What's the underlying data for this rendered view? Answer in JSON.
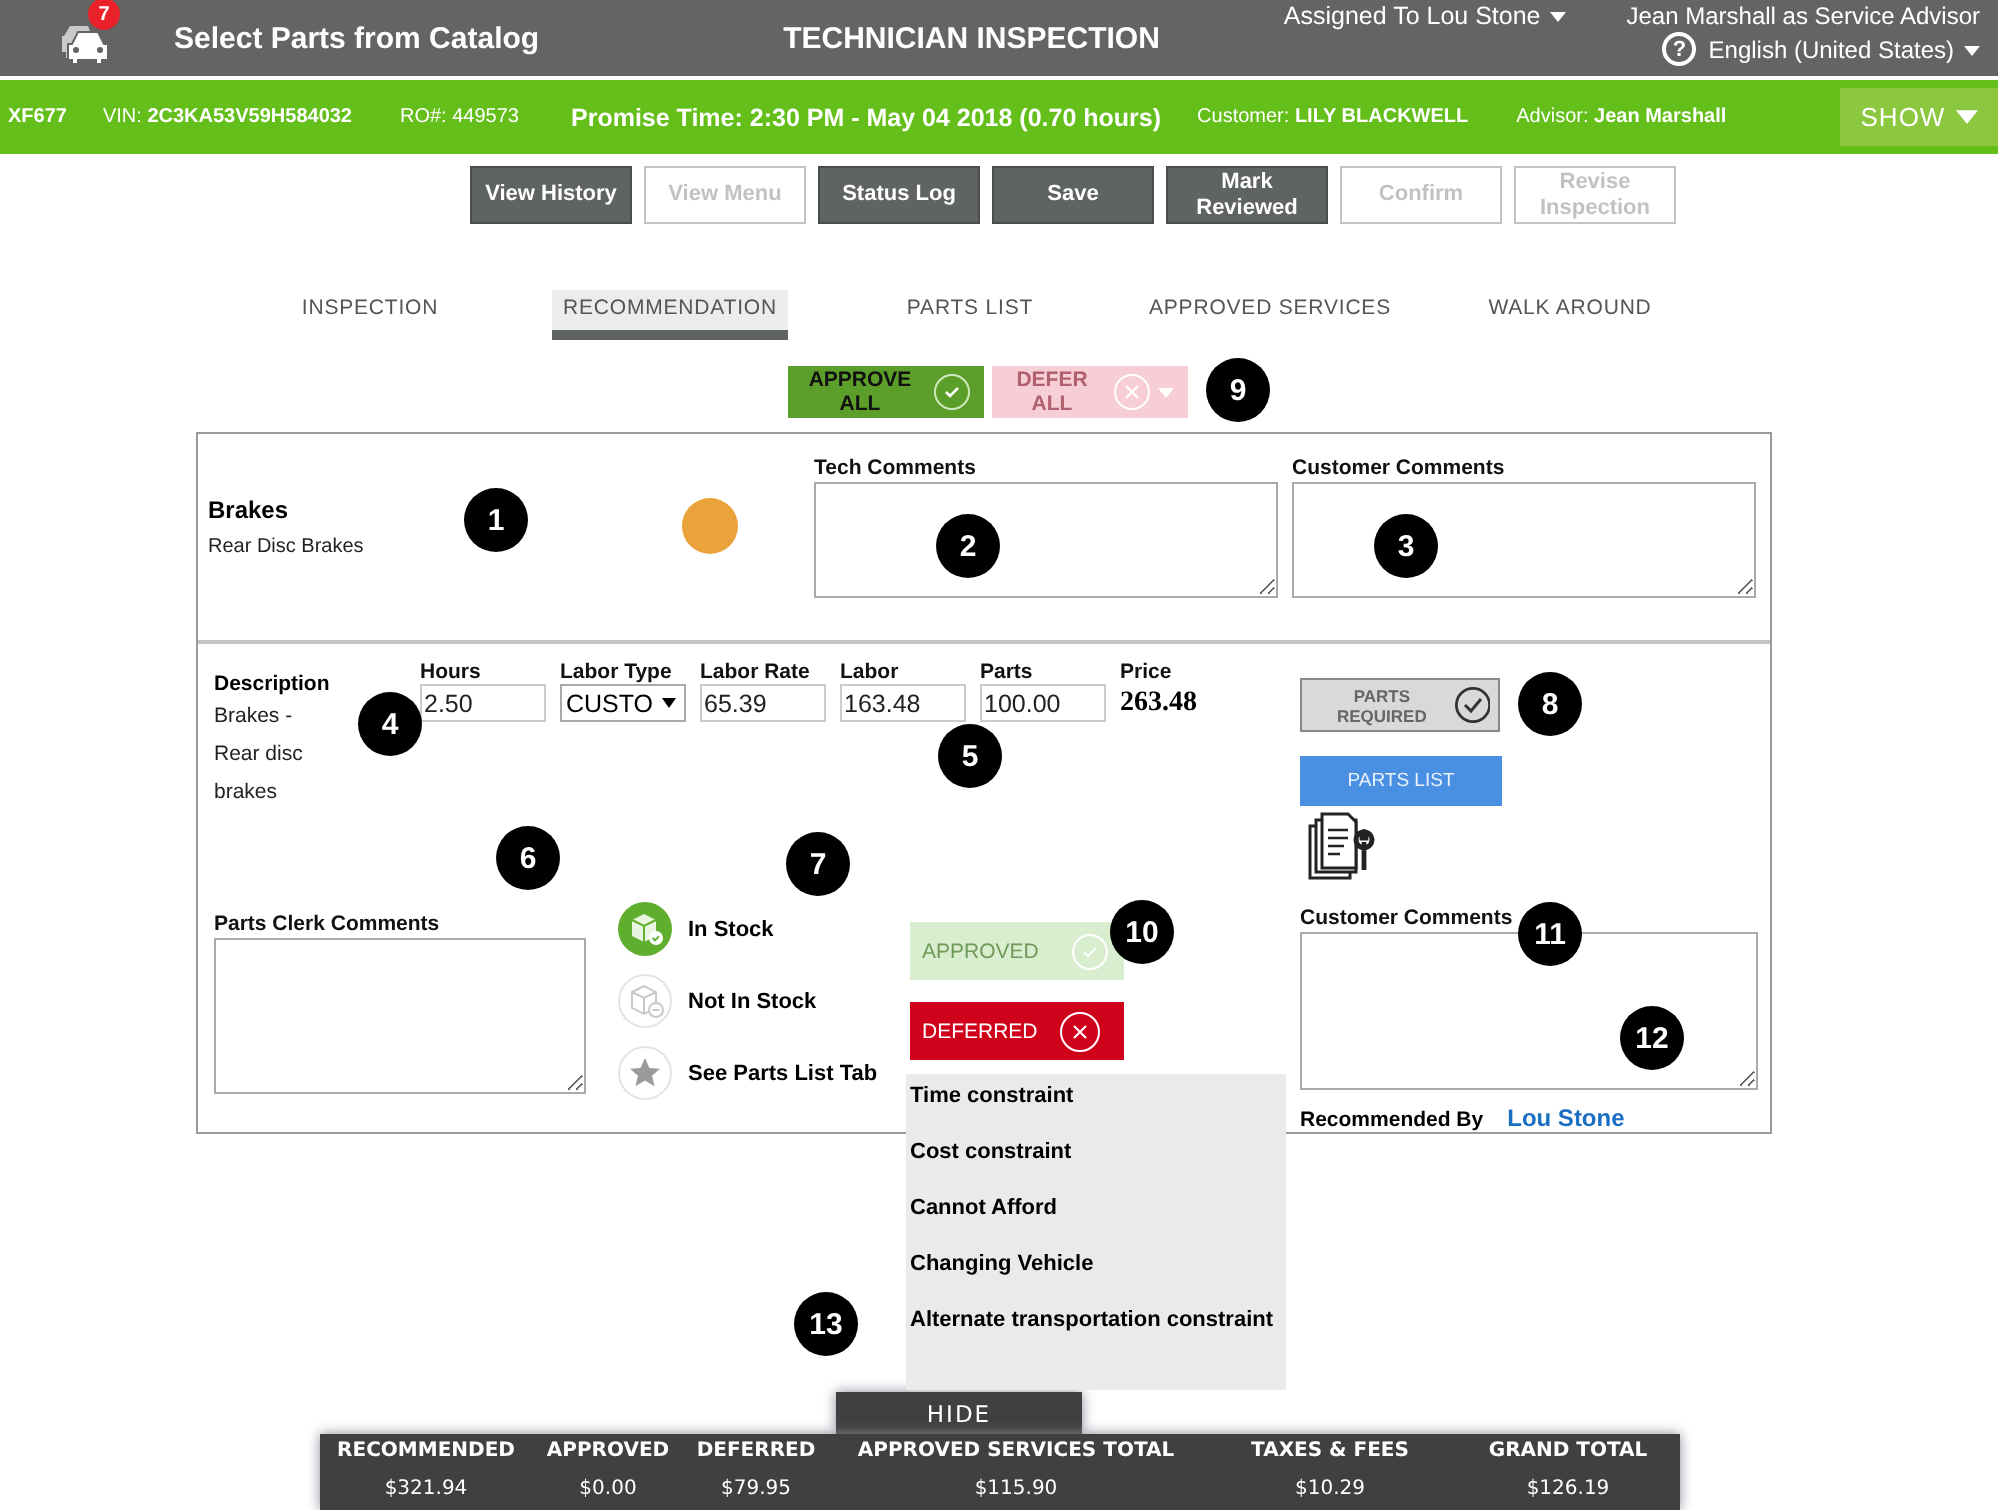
{
  "header": {
    "notification_count": "7",
    "catalog_link": "Select Parts from Catalog",
    "title": "TECHNICIAN INSPECTION",
    "assigned": "Assigned To Lou Stone",
    "user": "Jean Marshall as Service Advisor",
    "help": "?",
    "language": "English (United States)"
  },
  "vehicle_bar": {
    "tag": "XF677",
    "vin_label": "VIN:",
    "vin": "2C3KA53V59H584032",
    "ro_label": "RO#:",
    "ro": "449573",
    "promise_time": "Promise Time: 2:30 PM - May 04 2018 (0.70 hours)",
    "customer_label": "Customer:",
    "customer": "LILY BLACKWELL",
    "advisor_label": "Advisor:",
    "advisor": "Jean Marshall",
    "show": "SHOW"
  },
  "toolbar": [
    {
      "label": "View History",
      "disabled": false
    },
    {
      "label": "View Menu",
      "disabled": true
    },
    {
      "label": "Status Log",
      "disabled": false
    },
    {
      "label": "Save",
      "disabled": false
    },
    {
      "label": "Mark Reviewed",
      "disabled": false
    },
    {
      "label": "Confirm",
      "disabled": true
    },
    {
      "label": "Revise Inspection",
      "disabled": true
    }
  ],
  "tabs": [
    {
      "label": "INSPECTION",
      "selected": false
    },
    {
      "label": "RECOMMENDATION",
      "selected": true
    },
    {
      "label": "PARTS LIST",
      "selected": false
    },
    {
      "label": "APPROVED SERVICES",
      "selected": false
    },
    {
      "label": "WALK AROUND",
      "selected": false
    }
  ],
  "bulk_actions": {
    "approve_all": {
      "label": "APPROVE ALL",
      "disabled": false
    },
    "defer_all": {
      "label": "DEFER ALL",
      "disabled": true
    }
  },
  "recommendation": {
    "name": "Brakes",
    "subtitle": "Rear Disc Brakes",
    "color": "#eaa23a",
    "tech_comments": {
      "label": "Tech Comments"
    },
    "customer_comments": {
      "label": "Customer Comments"
    },
    "description_label": "Description",
    "description": "Brakes - Rear disc brakes",
    "fields": [
      {
        "label": "Hours",
        "value": "2.50",
        "kind": "input"
      },
      {
        "label": "Labor Type",
        "value": "CUSTO",
        "kind": "select"
      },
      {
        "label": "Labor Rate",
        "value": "65.39",
        "kind": "input"
      },
      {
        "label": "Labor",
        "value": "163.48",
        "kind": "input"
      },
      {
        "label": "Parts",
        "value": "100.00",
        "kind": "input"
      },
      {
        "label": "Price",
        "value": "263.48",
        "kind": "text"
      }
    ],
    "parts_required": {
      "label": "PARTS REQUIRED",
      "checked": true
    },
    "parts_list_button": "PARTS LIST",
    "parts_clerk_comments": {
      "label": "Parts Clerk Comments"
    },
    "stock_legend": [
      {
        "kind": "in_stock",
        "label": "In Stock"
      },
      {
        "kind": "not_in_stock",
        "label": "Not In Stock"
      },
      {
        "kind": "parts_list",
        "label": "See Parts List Tab"
      }
    ],
    "approved": {
      "label": "APPROVED",
      "selected": false
    },
    "deferred": {
      "label": "DEFERRED",
      "selected": true,
      "expanded": true
    },
    "defer_reasons": [
      "Time constraint",
      "Cost constraint",
      "Cannot Afford",
      "Changing Vehicle",
      "Alternate transportation constraint"
    ],
    "customer_comments_2": {
      "label": "Customer Comments"
    },
    "recommended_by_label": "Recommended By",
    "recommended_by": "Lou Stone"
  },
  "callouts": [
    "1",
    "2",
    "3",
    "4",
    "5",
    "6",
    "7",
    "8",
    "9",
    "10",
    "11",
    "12",
    "13"
  ],
  "hide_button": "HIDE",
  "totals": [
    {
      "label": "RECOMMENDED",
      "value": "$321.94"
    },
    {
      "label": "APPROVED",
      "value": "$0.00"
    },
    {
      "label": "DEFERRED",
      "value": "$79.95"
    },
    {
      "label": "APPROVED SERVICES TOTAL",
      "value": "$115.90"
    },
    {
      "label": "TAXES & FEES",
      "value": "$10.29"
    },
    {
      "label": "GRAND TOTAL",
      "value": "$126.19"
    }
  ]
}
